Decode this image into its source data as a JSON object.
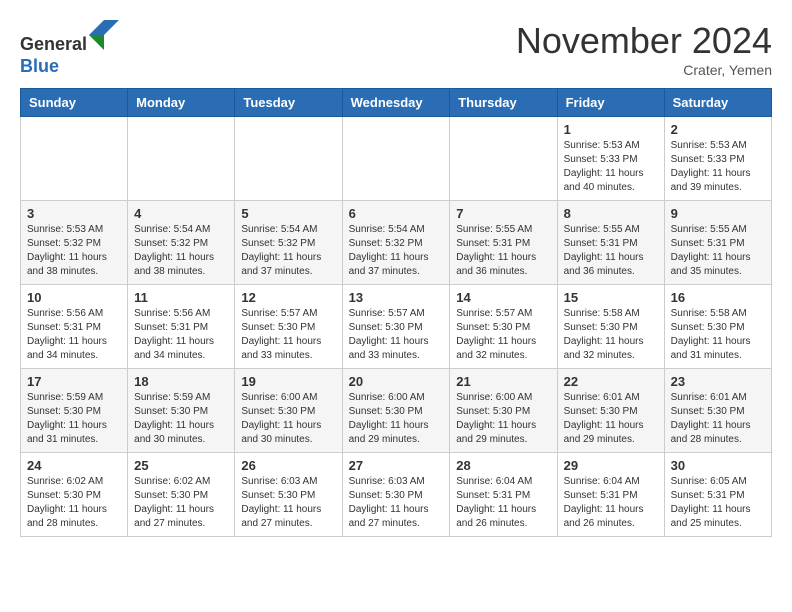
{
  "header": {
    "logo_line1": "General",
    "logo_line2": "Blue",
    "month": "November 2024",
    "location": "Crater, Yemen"
  },
  "days_of_week": [
    "Sunday",
    "Monday",
    "Tuesday",
    "Wednesday",
    "Thursday",
    "Friday",
    "Saturday"
  ],
  "weeks": [
    [
      {
        "day": "",
        "content": ""
      },
      {
        "day": "",
        "content": ""
      },
      {
        "day": "",
        "content": ""
      },
      {
        "day": "",
        "content": ""
      },
      {
        "day": "",
        "content": ""
      },
      {
        "day": "1",
        "content": "Sunrise: 5:53 AM\nSunset: 5:33 PM\nDaylight: 11 hours and 40 minutes."
      },
      {
        "day": "2",
        "content": "Sunrise: 5:53 AM\nSunset: 5:33 PM\nDaylight: 11 hours and 39 minutes."
      }
    ],
    [
      {
        "day": "3",
        "content": "Sunrise: 5:53 AM\nSunset: 5:32 PM\nDaylight: 11 hours and 38 minutes."
      },
      {
        "day": "4",
        "content": "Sunrise: 5:54 AM\nSunset: 5:32 PM\nDaylight: 11 hours and 38 minutes."
      },
      {
        "day": "5",
        "content": "Sunrise: 5:54 AM\nSunset: 5:32 PM\nDaylight: 11 hours and 37 minutes."
      },
      {
        "day": "6",
        "content": "Sunrise: 5:54 AM\nSunset: 5:32 PM\nDaylight: 11 hours and 37 minutes."
      },
      {
        "day": "7",
        "content": "Sunrise: 5:55 AM\nSunset: 5:31 PM\nDaylight: 11 hours and 36 minutes."
      },
      {
        "day": "8",
        "content": "Sunrise: 5:55 AM\nSunset: 5:31 PM\nDaylight: 11 hours and 36 minutes."
      },
      {
        "day": "9",
        "content": "Sunrise: 5:55 AM\nSunset: 5:31 PM\nDaylight: 11 hours and 35 minutes."
      }
    ],
    [
      {
        "day": "10",
        "content": "Sunrise: 5:56 AM\nSunset: 5:31 PM\nDaylight: 11 hours and 34 minutes."
      },
      {
        "day": "11",
        "content": "Sunrise: 5:56 AM\nSunset: 5:31 PM\nDaylight: 11 hours and 34 minutes."
      },
      {
        "day": "12",
        "content": "Sunrise: 5:57 AM\nSunset: 5:30 PM\nDaylight: 11 hours and 33 minutes."
      },
      {
        "day": "13",
        "content": "Sunrise: 5:57 AM\nSunset: 5:30 PM\nDaylight: 11 hours and 33 minutes."
      },
      {
        "day": "14",
        "content": "Sunrise: 5:57 AM\nSunset: 5:30 PM\nDaylight: 11 hours and 32 minutes."
      },
      {
        "day": "15",
        "content": "Sunrise: 5:58 AM\nSunset: 5:30 PM\nDaylight: 11 hours and 32 minutes."
      },
      {
        "day": "16",
        "content": "Sunrise: 5:58 AM\nSunset: 5:30 PM\nDaylight: 11 hours and 31 minutes."
      }
    ],
    [
      {
        "day": "17",
        "content": "Sunrise: 5:59 AM\nSunset: 5:30 PM\nDaylight: 11 hours and 31 minutes."
      },
      {
        "day": "18",
        "content": "Sunrise: 5:59 AM\nSunset: 5:30 PM\nDaylight: 11 hours and 30 minutes."
      },
      {
        "day": "19",
        "content": "Sunrise: 6:00 AM\nSunset: 5:30 PM\nDaylight: 11 hours and 30 minutes."
      },
      {
        "day": "20",
        "content": "Sunrise: 6:00 AM\nSunset: 5:30 PM\nDaylight: 11 hours and 29 minutes."
      },
      {
        "day": "21",
        "content": "Sunrise: 6:00 AM\nSunset: 5:30 PM\nDaylight: 11 hours and 29 minutes."
      },
      {
        "day": "22",
        "content": "Sunrise: 6:01 AM\nSunset: 5:30 PM\nDaylight: 11 hours and 29 minutes."
      },
      {
        "day": "23",
        "content": "Sunrise: 6:01 AM\nSunset: 5:30 PM\nDaylight: 11 hours and 28 minutes."
      }
    ],
    [
      {
        "day": "24",
        "content": "Sunrise: 6:02 AM\nSunset: 5:30 PM\nDaylight: 11 hours and 28 minutes."
      },
      {
        "day": "25",
        "content": "Sunrise: 6:02 AM\nSunset: 5:30 PM\nDaylight: 11 hours and 27 minutes."
      },
      {
        "day": "26",
        "content": "Sunrise: 6:03 AM\nSunset: 5:30 PM\nDaylight: 11 hours and 27 minutes."
      },
      {
        "day": "27",
        "content": "Sunrise: 6:03 AM\nSunset: 5:30 PM\nDaylight: 11 hours and 27 minutes."
      },
      {
        "day": "28",
        "content": "Sunrise: 6:04 AM\nSunset: 5:31 PM\nDaylight: 11 hours and 26 minutes."
      },
      {
        "day": "29",
        "content": "Sunrise: 6:04 AM\nSunset: 5:31 PM\nDaylight: 11 hours and 26 minutes."
      },
      {
        "day": "30",
        "content": "Sunrise: 6:05 AM\nSunset: 5:31 PM\nDaylight: 11 hours and 25 minutes."
      }
    ]
  ]
}
